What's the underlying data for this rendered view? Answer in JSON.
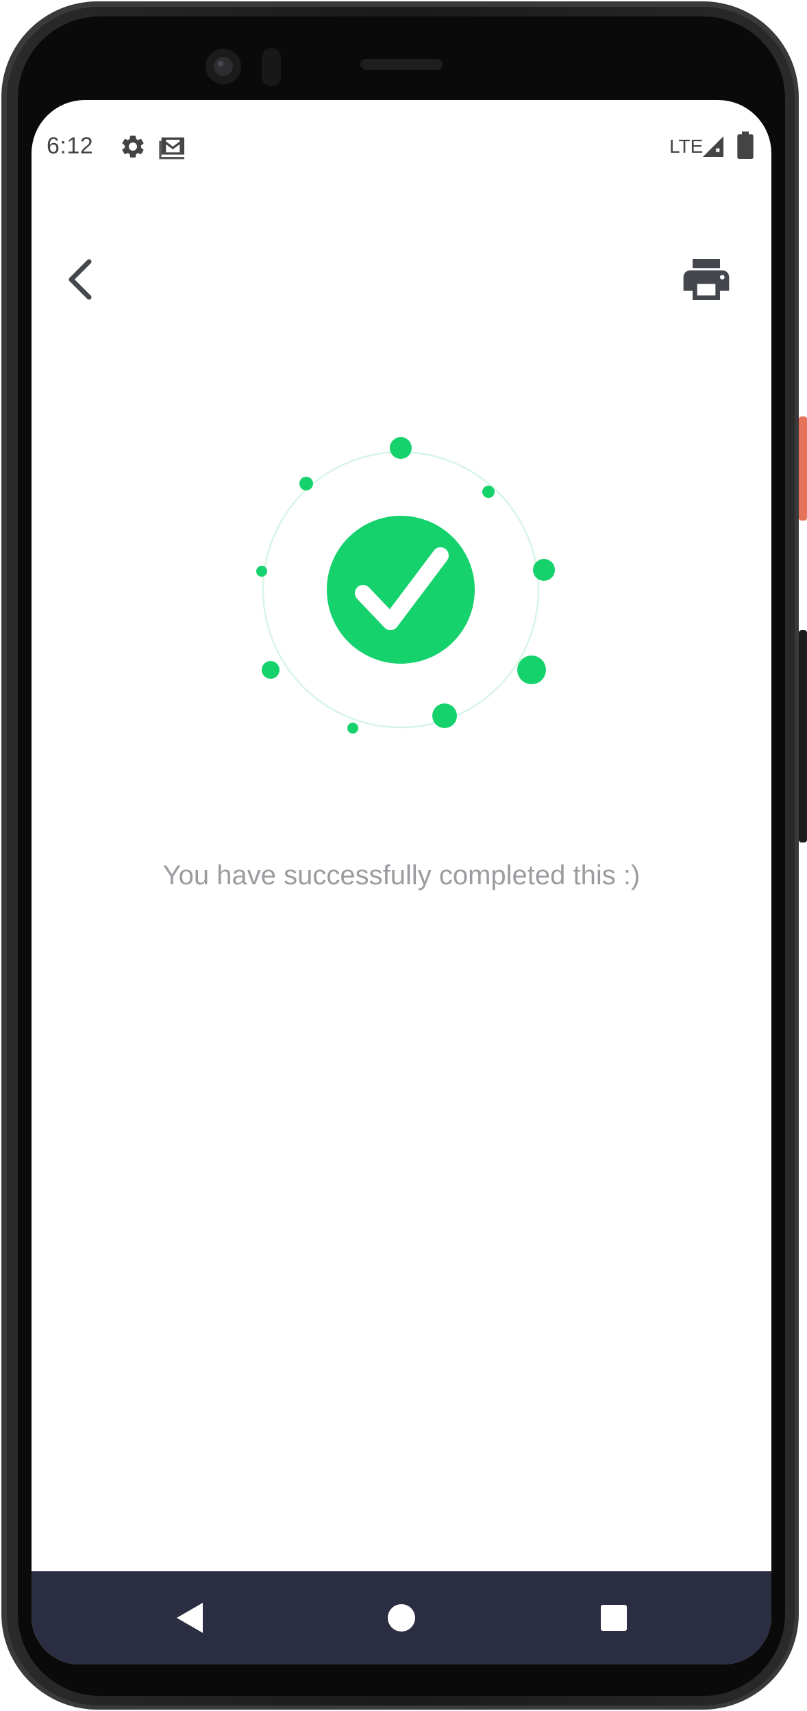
{
  "status_bar": {
    "time": "6:12",
    "network": "LTE",
    "icons": [
      "gear-icon",
      "gmail-icon",
      "signal-icon",
      "battery-icon"
    ]
  },
  "app_bar": {
    "back_icon": "chevron-left-icon",
    "print_icon": "printer-icon"
  },
  "success": {
    "message": "You have successfully completed this :)",
    "icon": "check-icon",
    "accent_color": "#16d26c",
    "ring_color": "#d7f5e6"
  },
  "nav_bar": {
    "background": "#2b2d42",
    "buttons": [
      "nav-back-icon",
      "nav-home-icon",
      "nav-recents-icon"
    ]
  },
  "colors": {
    "text_secondary": "#9a9ca0",
    "icon_dark": "#45474f",
    "device_frame": "#111111"
  }
}
